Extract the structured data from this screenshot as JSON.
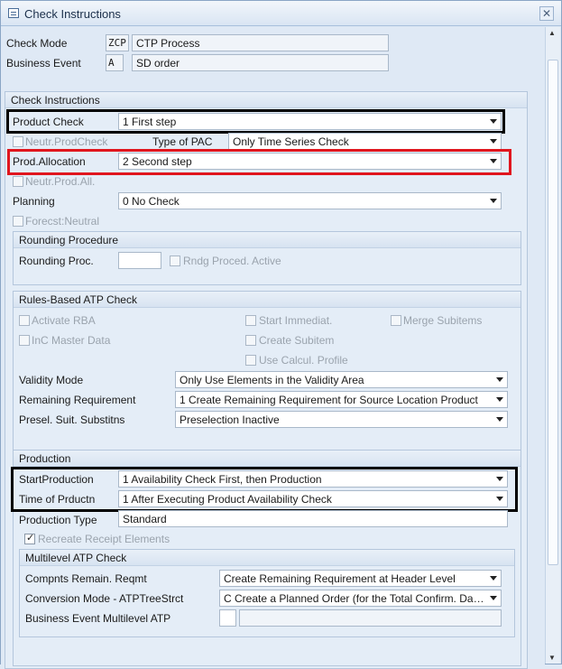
{
  "window": {
    "title": "Check Instructions",
    "close": "✕"
  },
  "header": {
    "check_mode_label": "Check Mode",
    "check_mode_code": "ZCP",
    "check_mode_value": "CTP Process",
    "business_event_label": "Business Event",
    "business_event_code": "A",
    "business_event_value": "SD order"
  },
  "check_instructions": {
    "title": "Check Instructions",
    "product_check_label": "Product Check",
    "product_check_value": "1 First step",
    "neutr_prodcheck_label": "Neutr.ProdCheck",
    "type_of_pac_label": "Type of PAC",
    "type_of_pac_value": "Only Time Series Check",
    "prod_allocation_label": "Prod.Allocation",
    "prod_allocation_value": "2 Second step",
    "neutr_prod_all_label": "Neutr.Prod.All.",
    "planning_label": "Planning",
    "planning_value": "0 No Check",
    "forecst_neutral_label": "Forecst:Neutral"
  },
  "rounding": {
    "title": "Rounding Procedure",
    "rounding_proc_label": "Rounding Proc.",
    "rounding_proc_value": "",
    "rndg_active_label": "Rndg Proced. Active"
  },
  "rba": {
    "title": "Rules-Based ATP Check",
    "activate_rba": "Activate RBA",
    "start_immediat": "Start Immediat.",
    "merge_subitems": "Merge Subitems",
    "inc_master_data": "InC Master Data",
    "create_subitem": "Create Subitem",
    "use_calcul_profile": "Use Calcul. Profile",
    "validity_mode_label": "Validity Mode",
    "validity_mode_value": "Only Use Elements in the Validity Area",
    "remaining_req_label": "Remaining Requirement",
    "remaining_req_value": "1 Create Remaining Requirement for Source Location Product",
    "presel_label": "Presel. Suit. Substitns",
    "presel_value": "Preselection Inactive"
  },
  "production": {
    "title": "Production",
    "start_production_label": "StartProduction",
    "start_production_value": "1 Availability Check First, then Production",
    "time_of_prductn_label": "Time of Prductn",
    "time_of_prductn_value": "1 After Executing Product Availability Check",
    "production_type_label": "Production Type",
    "production_type_value": "Standard",
    "recreate_receipt_label": "Recreate Receipt Elements"
  },
  "multilevel": {
    "title": "Multilevel ATP Check",
    "compnts_label": "Compnts Remain. Reqmt",
    "compnts_value": "Create Remaining Requirement at Header Level",
    "conversion_label": "Conversion Mode - ATPTreeStrct",
    "conversion_value": "C Create a Planned Order (for the Total Confirm. Da…",
    "business_event_ml_label": "Business Event Multilevel ATP",
    "business_event_ml_code": "",
    "business_event_ml_value": ""
  },
  "colors": {
    "highlight_black": "#000000",
    "highlight_red": "#e0161e"
  }
}
